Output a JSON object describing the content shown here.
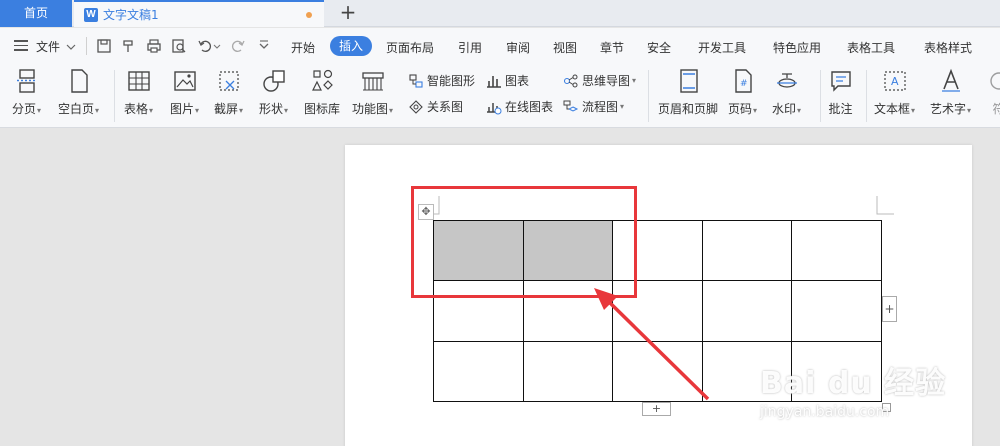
{
  "tabs": {
    "home": "首页",
    "doc_title": "文字文稿1",
    "doc_icon_letter": "W",
    "new_tab": "+"
  },
  "menu": {
    "file": "文件",
    "ribbon_tabs": [
      "开始",
      "插入",
      "页面布局",
      "引用",
      "审阅",
      "视图",
      "章节",
      "安全",
      "开发工具",
      "特色应用",
      "表格工具",
      "表格样式"
    ],
    "active_tab": "插入"
  },
  "ribbon": {
    "page_break": "分页",
    "blank_page": "空白页",
    "table": "表格",
    "picture": "图片",
    "screenshot": "截屏",
    "shape": "形状",
    "icon_lib": "图标库",
    "func_chart": "功能图",
    "smart_shape": "智能图形",
    "chart": "图表",
    "mind_map": "思维导图",
    "relation_chart": "关系图",
    "online_chart": "在线图表",
    "flowchart": "流程图",
    "header_footer": "页眉和页脚",
    "page_number": "页码",
    "watermark": "水印",
    "comment": "批注",
    "textbox": "文本框",
    "wordart": "艺术字",
    "symbol": "符"
  },
  "document": {
    "table_rows": 3,
    "table_cols": 5,
    "selected_cells": [
      [
        0,
        0
      ],
      [
        0,
        1
      ]
    ],
    "add_row_label": "+",
    "add_col_label": "+"
  },
  "annotation": {
    "color": "#e8373b"
  },
  "watermark": {
    "line1": "Bai du 经验",
    "line2": "jingyan.baidu.com"
  },
  "colors": {
    "accent": "#3b7fe0",
    "selected_cell": "#c6c6c6"
  }
}
